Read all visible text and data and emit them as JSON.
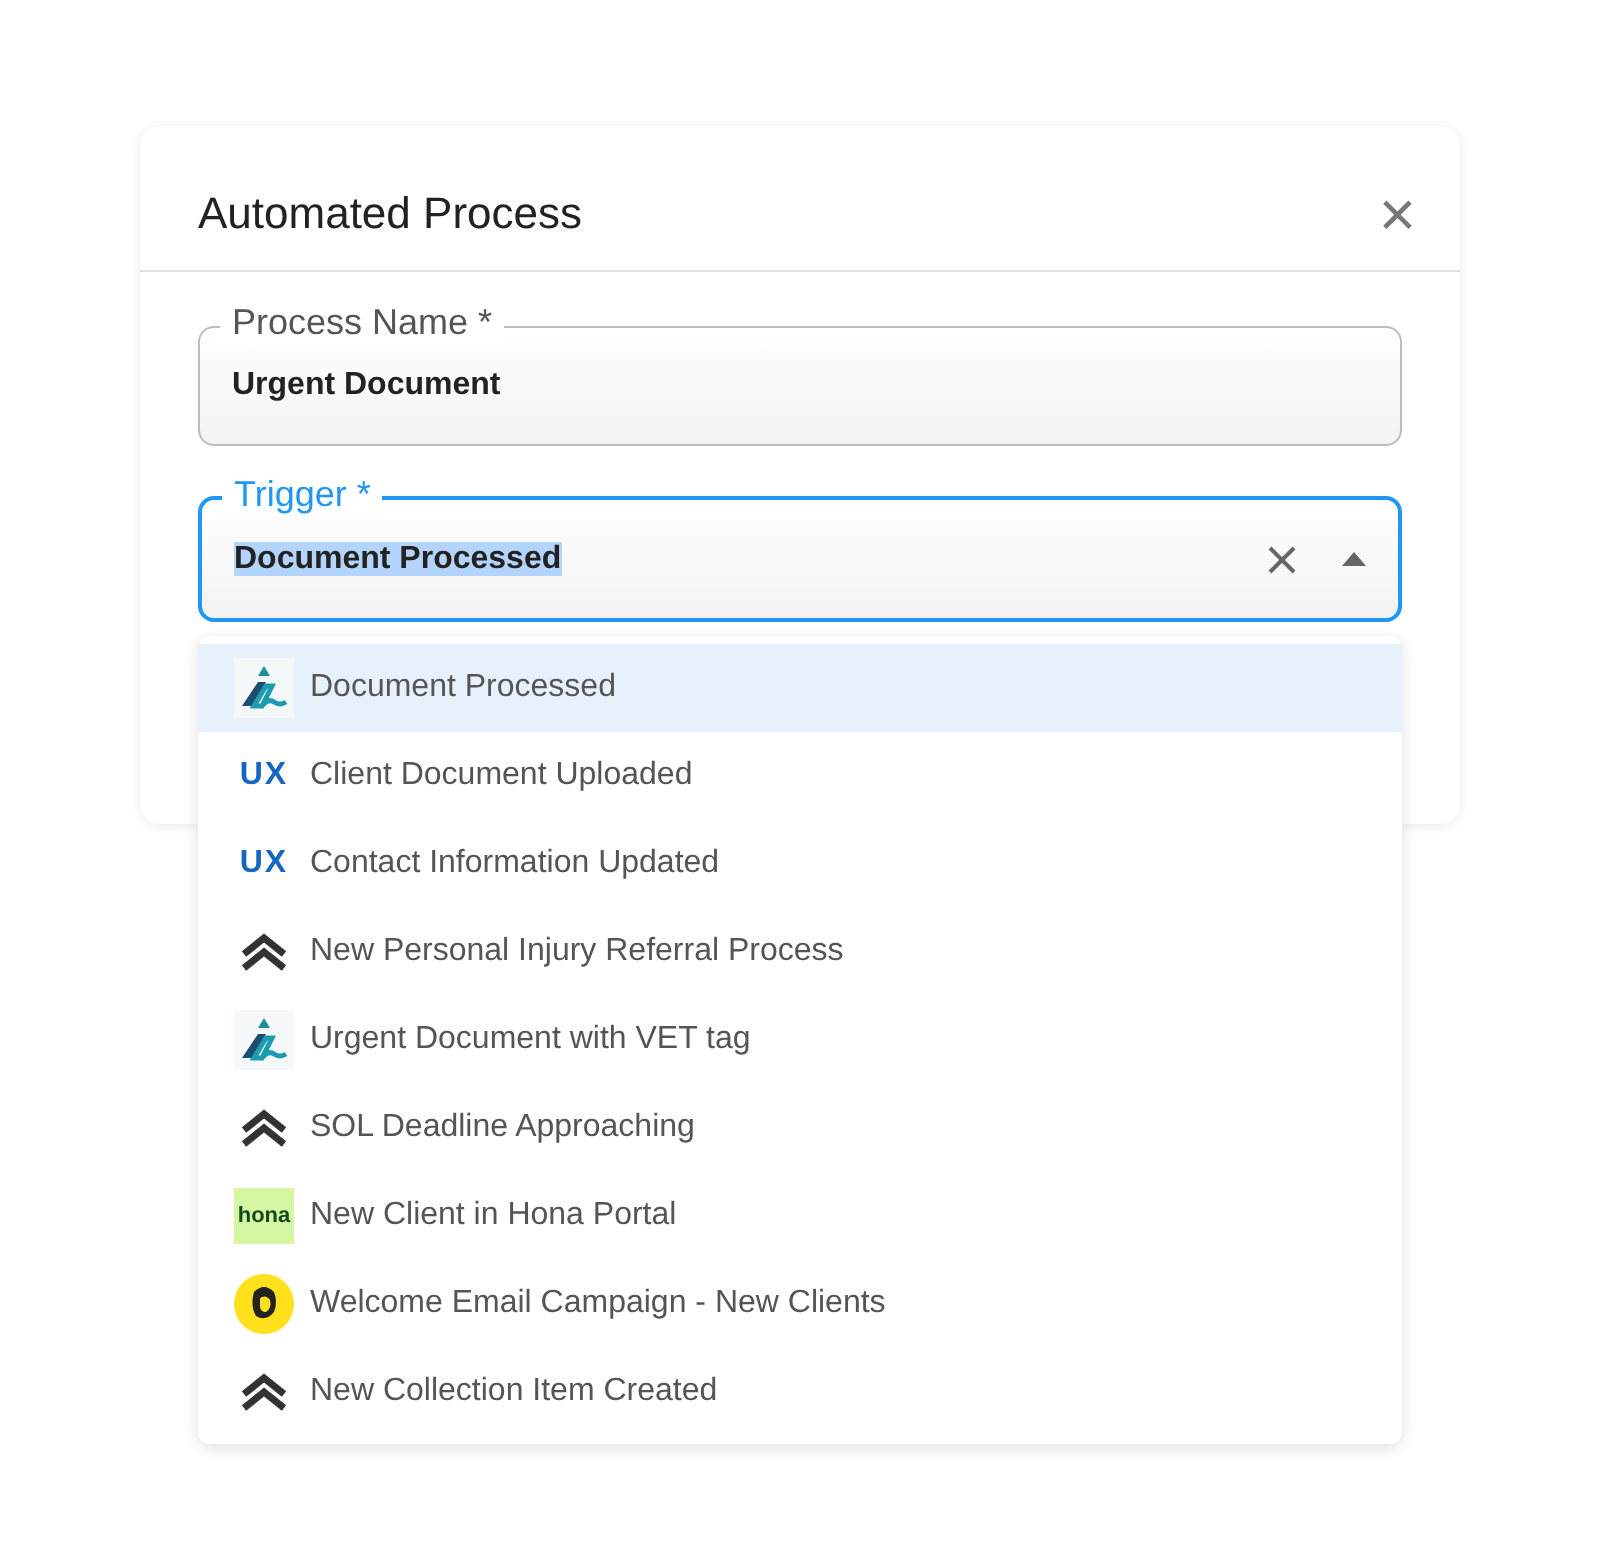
{
  "dialog": {
    "title": "Automated Process",
    "close_icon": "×"
  },
  "fields": [
    {
      "label": "Process Name *",
      "value": "Urgent Document",
      "focused": false,
      "text_selected": false
    },
    {
      "label": "Trigger *",
      "value": "Document Processed",
      "focused": true,
      "text_selected": true,
      "clearable": true,
      "open": true
    }
  ],
  "options": [
    {
      "label": "Document Processed",
      "kind": "peak",
      "selected": true
    },
    {
      "label": "Client Document Uploaded",
      "kind": "ux",
      "logo_text": "UX",
      "selected": false
    },
    {
      "label": "Contact Information Updated",
      "kind": "ux",
      "logo_text": "UX",
      "selected": false
    },
    {
      "label": "New Personal Injury Referral Process",
      "kind": "chevrons",
      "selected": false
    },
    {
      "label": "Urgent Document with VET tag",
      "kind": "peak",
      "selected": false
    },
    {
      "label": "SOL Deadline Approaching",
      "kind": "chevrons",
      "selected": false
    },
    {
      "label": "New Client in Hona Portal",
      "kind": "hona",
      "logo_text": "hona",
      "selected": false
    },
    {
      "label": "Welcome Email Campaign - New Clients",
      "kind": "mail",
      "selected": false
    },
    {
      "label": "New Collection Item Created",
      "kind": "chevrons",
      "selected": false
    }
  ]
}
